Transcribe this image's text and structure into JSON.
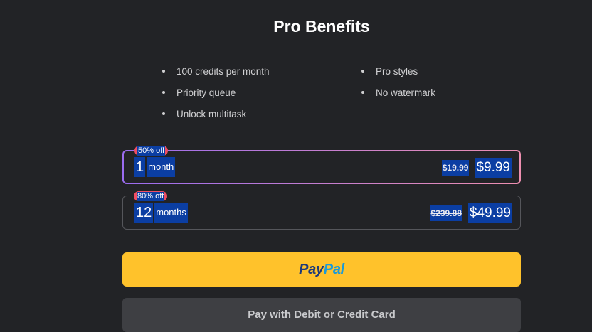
{
  "title": "Pro Benefits",
  "benefits": [
    "100 credits per month",
    "Pro styles",
    "Priority queue",
    "No watermark",
    "Unlock multitask"
  ],
  "plans": [
    {
      "badge": "50% off",
      "duration": "1",
      "unit": "month",
      "old_price": "$19.99",
      "price": "$9.99",
      "selected": true
    },
    {
      "badge": "80% off",
      "duration": "12",
      "unit": "months",
      "old_price": "$239.88",
      "price": "$49.99",
      "selected": false
    }
  ],
  "paypal": {
    "pay": "Pay",
    "pal": "Pal"
  },
  "card_button": "Pay with Debit or Credit Card",
  "colors": {
    "background": "#222326",
    "paypal": "#ffc22b",
    "badge": "#f04d63",
    "highlight": "#0b3ea3"
  }
}
